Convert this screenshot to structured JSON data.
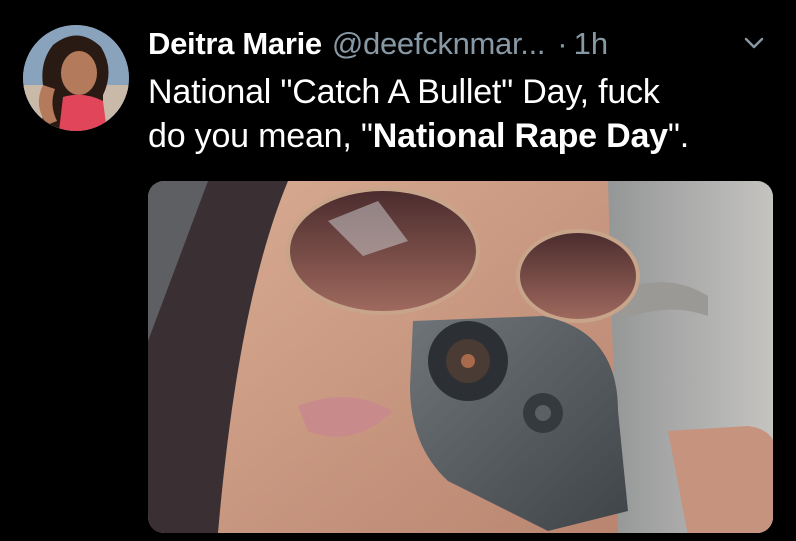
{
  "tweet": {
    "display_name": "Deitra Marie",
    "handle": "@deefcknmar...",
    "separator": "·",
    "time": "1h",
    "text_line1": "National \"Catch A Bullet\" Day, fuck",
    "text_line2_prefix": "do you mean, \"",
    "text_line2_bold": "National Rape Day",
    "text_line2_suffix": "\"."
  },
  "icons": {
    "menu": "chevron-down-icon"
  },
  "colors": {
    "background": "#000000",
    "text_primary": "#ffffff",
    "text_secondary": "#8899a6"
  }
}
